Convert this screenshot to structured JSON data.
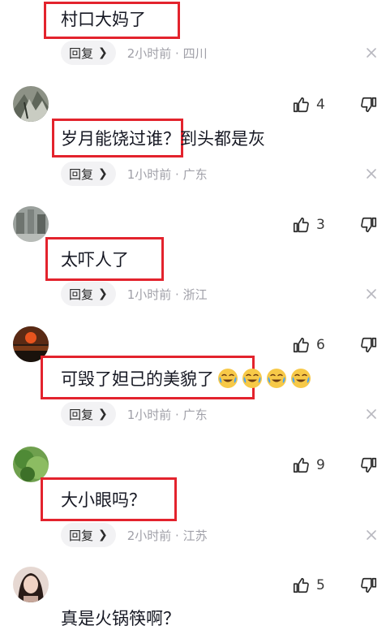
{
  "comments": [
    {
      "text": "村口大妈了",
      "reply_label": "回复",
      "meta": "2小时前 · 四川"
    },
    {
      "likes": "4",
      "text": "岁月能饶过谁？到头都是灰",
      "reply_label": "回复",
      "meta": "1小时前 · 广东"
    },
    {
      "likes": "3",
      "text": "太吓人了",
      "reply_label": "回复",
      "meta": "1小时前 · 浙江"
    },
    {
      "likes": "6",
      "text": "可毁了妲己的美貌了",
      "reply_label": "回复",
      "meta": "1小时前 · 广东"
    },
    {
      "likes": "9",
      "text": "大小眼吗？",
      "reply_label": "回复",
      "meta": "2小时前 · 江苏"
    },
    {
      "likes": "5",
      "text": "真是火锅筷啊？"
    }
  ],
  "colors": {
    "highlight_box": "#e3232d",
    "meta_text": "#a0a0a8",
    "reply_bg": "#f2f2f4"
  },
  "icons": {
    "like": "thumbs-up-icon",
    "dislike": "thumbs-down-icon",
    "close": "close-icon",
    "emoji": "crying-laughing-emoji"
  }
}
